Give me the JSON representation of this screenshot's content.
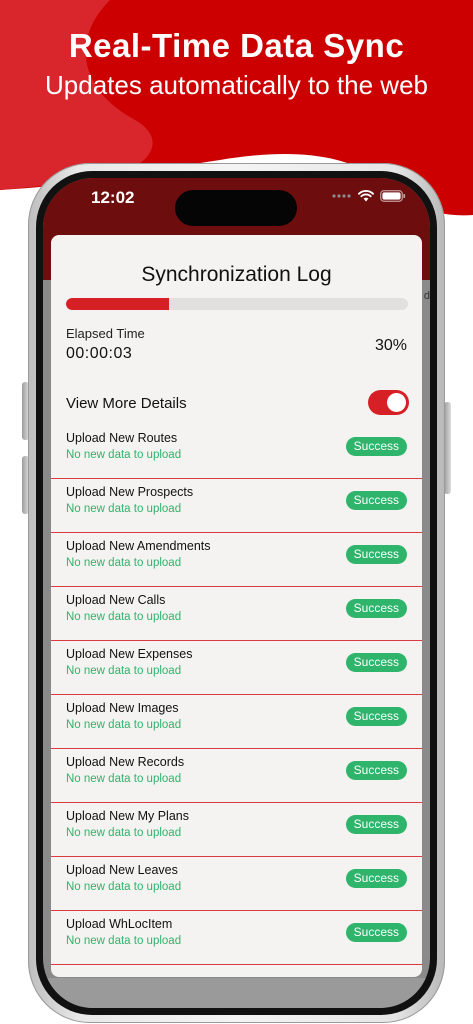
{
  "banner": {
    "title": "Real-Time Data Sync",
    "subtitle": "Updates automatically to the web"
  },
  "status_bar": {
    "time": "12:02"
  },
  "card": {
    "title": "Synchronization Log",
    "progress_percent": 30,
    "elapsed_label": "Elapsed Time",
    "elapsed_value": "00:00:03",
    "percent_text": "30%",
    "details_label": "View More Details",
    "details_enabled": true
  },
  "log_items": [
    {
      "name": "Upload New Routes",
      "status": "No new data to upload",
      "badge": "Success"
    },
    {
      "name": "Upload New Prospects",
      "status": "No new data to upload",
      "badge": "Success"
    },
    {
      "name": "Upload New Amendments",
      "status": "No new data to upload",
      "badge": "Success"
    },
    {
      "name": "Upload New Calls",
      "status": "No new data to upload",
      "badge": "Success"
    },
    {
      "name": "Upload New Expenses",
      "status": "No new data to upload",
      "badge": "Success"
    },
    {
      "name": "Upload New Images",
      "status": "No new data to upload",
      "badge": "Success"
    },
    {
      "name": "Upload New Records",
      "status": "No new data to upload",
      "badge": "Success"
    },
    {
      "name": "Upload New My Plans",
      "status": "No new data to upload",
      "badge": "Success"
    },
    {
      "name": "Upload New Leaves",
      "status": "No new data to upload",
      "badge": "Success"
    },
    {
      "name": "Upload WhLocItem",
      "status": "No new data to upload",
      "badge": "Success"
    }
  ],
  "colors": {
    "brand_red": "#d71f26",
    "appbar_dark_red": "#6e0d0e",
    "success_green": "#2eb46b"
  },
  "icons": {
    "signal": "signal-dots-icon",
    "wifi": "wifi-icon",
    "battery": "battery-icon"
  }
}
